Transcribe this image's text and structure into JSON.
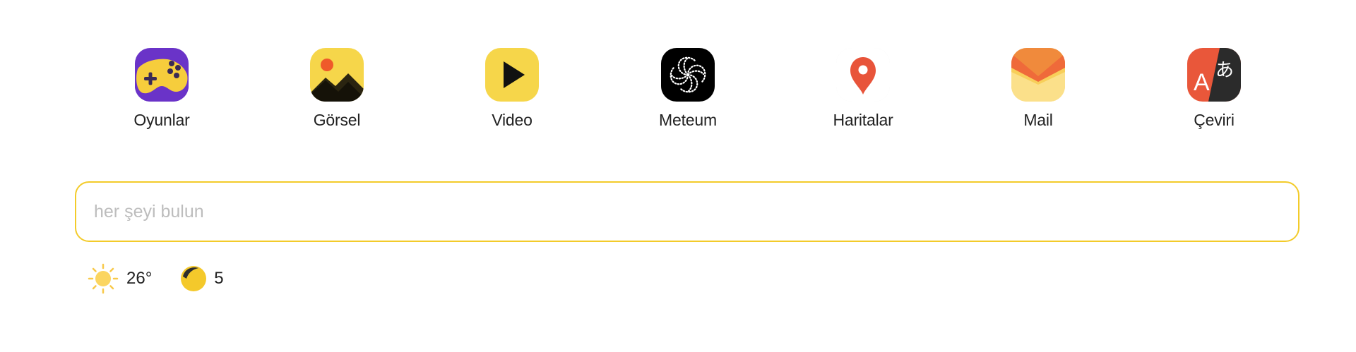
{
  "services": [
    {
      "label": "Oyunlar",
      "icon": "games-icon"
    },
    {
      "label": "Görsel",
      "icon": "images-icon"
    },
    {
      "label": "Video",
      "icon": "video-play-icon"
    },
    {
      "label": "Meteum",
      "icon": "meteum-swirl-icon"
    },
    {
      "label": "Haritalar",
      "icon": "map-pin-icon"
    },
    {
      "label": "Mail",
      "icon": "mail-envelope-icon"
    },
    {
      "label": "Çeviri",
      "icon": "translate-icon"
    }
  ],
  "search": {
    "placeholder": "her şeyi bulun",
    "value": ""
  },
  "weather": {
    "temperature": "26°",
    "icon": "sun-icon"
  },
  "traffic": {
    "level": "5",
    "icon": "traffic-level-icon"
  },
  "colors": {
    "accent": "#f3cb2a",
    "map_red": "#e8543a",
    "translate_red": "#e9573a"
  }
}
